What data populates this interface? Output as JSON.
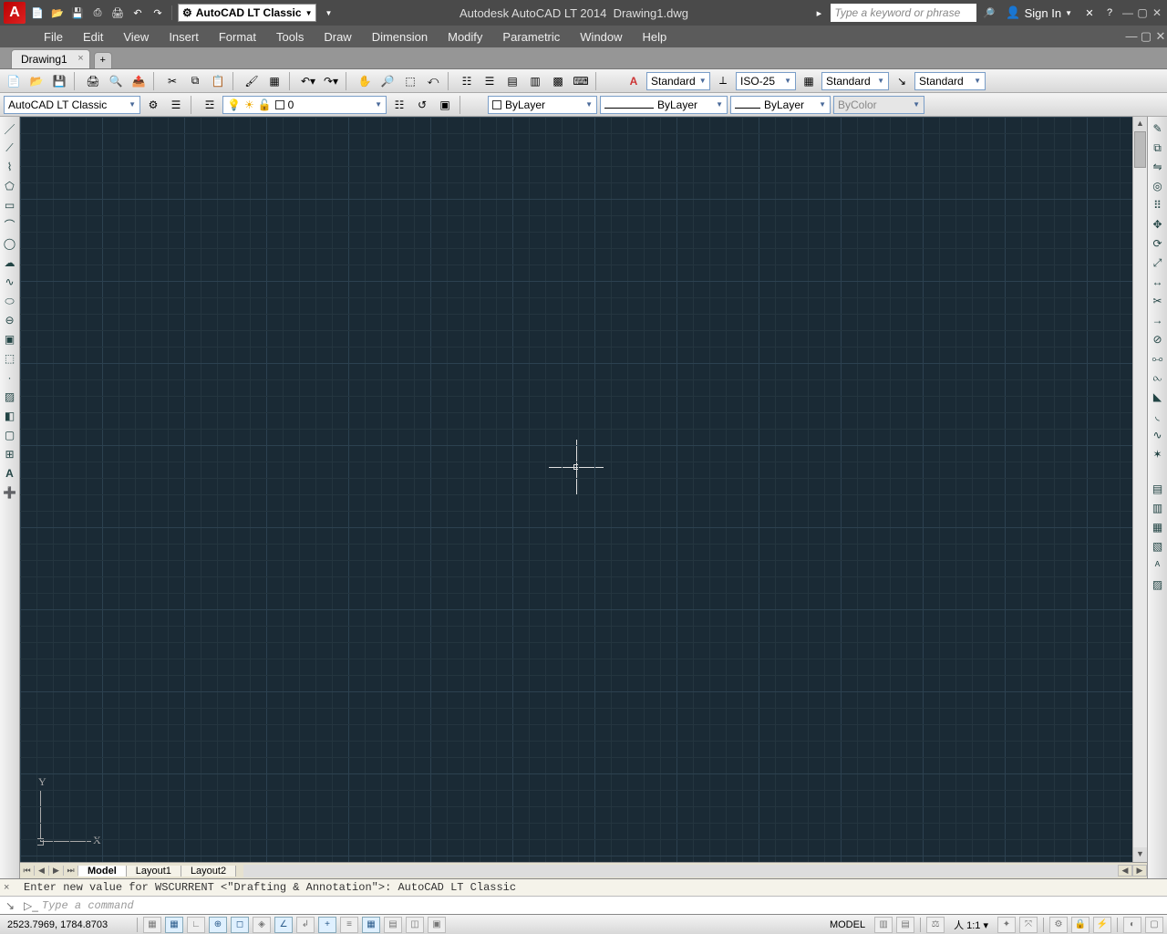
{
  "title": {
    "app": "Autodesk AutoCAD LT 2014",
    "file": "Drawing1.dwg",
    "workspace": "AutoCAD LT Classic",
    "search_placeholder": "Type a keyword or phrase",
    "signin": "Sign In"
  },
  "menu": [
    "File",
    "Edit",
    "View",
    "Insert",
    "Format",
    "Tools",
    "Draw",
    "Dimension",
    "Modify",
    "Parametric",
    "Window",
    "Help"
  ],
  "doc_tab": {
    "name": "Drawing1"
  },
  "styles": {
    "text_style": "Standard",
    "dim_style": "ISO-25",
    "table_style": "Standard",
    "mleader_style": "Standard"
  },
  "workspace_row": {
    "ws_select": "AutoCAD LT Classic",
    "layer_combo": "0"
  },
  "properties": {
    "color": "ByLayer",
    "linetype": "ByLayer",
    "lineweight": "ByLayer",
    "plotstyle": "ByColor"
  },
  "layout_tabs": [
    "Model",
    "Layout1",
    "Layout2"
  ],
  "command": {
    "history": "Enter new value for WSCURRENT <\"Drafting & Annotation\">: AutoCAD LT Classic",
    "prompt_placeholder": "Type a command"
  },
  "status": {
    "coords": "2523.7969, 1784.8703",
    "model_label": "MODEL",
    "scale_label": "1:1"
  },
  "ucs": {
    "x": "X",
    "y": "Y"
  }
}
